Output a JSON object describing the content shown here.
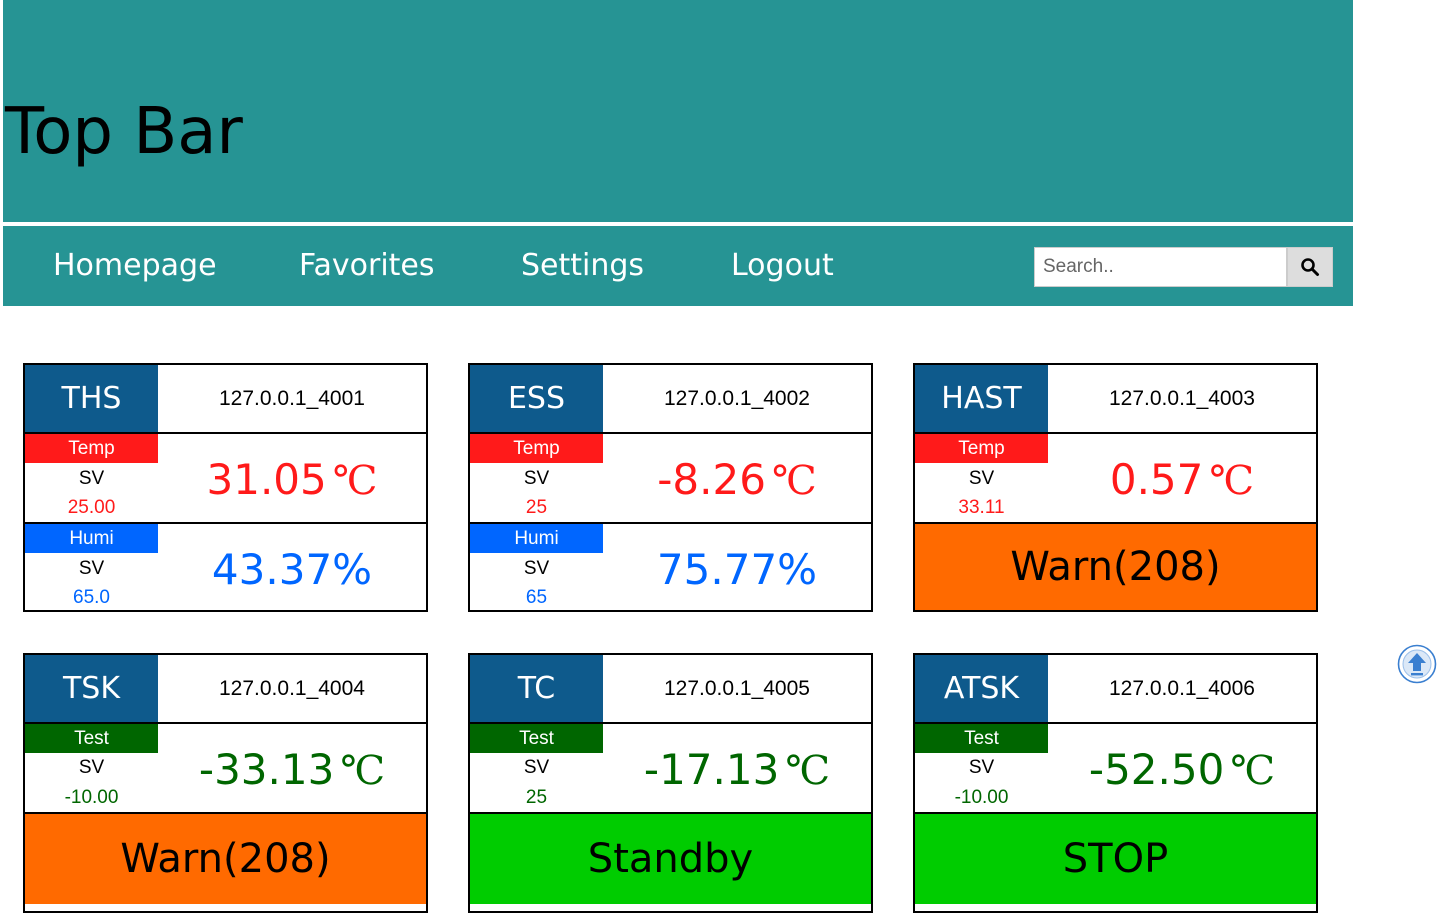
{
  "topbar": {
    "title": "Top Bar"
  },
  "nav": {
    "items": [
      "Homepage",
      "Favorites",
      "Settings",
      "Logout"
    ],
    "search_placeholder": "Search.."
  },
  "colors": {
    "teal": "#269494",
    "header_blue": "#0e5a8c",
    "temp_red": "#ff1a1a",
    "humi_blue": "#0066ff",
    "test_green": "#006600",
    "warn_orange": "#ff6a00",
    "ok_green": "#00cc00"
  },
  "icons": {
    "search": "search-icon",
    "scroll_top": "arrow-up-circle-icon"
  },
  "cards": [
    {
      "type": "THS",
      "id": "127.0.0.1_4001",
      "primary": {
        "badge": "Temp",
        "sv_label": "SV",
        "sv": "25.00",
        "value": "31.05",
        "unit": "℃"
      },
      "secondary": {
        "badge": "Humi",
        "sv_label": "SV",
        "sv": "65.0",
        "value": "43.37%"
      }
    },
    {
      "type": "ESS",
      "id": "127.0.0.1_4002",
      "primary": {
        "badge": "Temp",
        "sv_label": "SV",
        "sv": "25",
        "value": "-8.26",
        "unit": "℃"
      },
      "secondary": {
        "badge": "Humi",
        "sv_label": "SV",
        "sv": "65",
        "value": "75.77%"
      }
    },
    {
      "type": "HAST",
      "id": "127.0.0.1_4003",
      "primary": {
        "badge": "Temp",
        "sv_label": "SV",
        "sv": "33.11",
        "value": "0.57",
        "unit": "℃"
      },
      "status": "Warn(208)"
    },
    {
      "type": "TSK",
      "id": "127.0.0.1_4004",
      "primary": {
        "badge": "Test",
        "sv_label": "SV",
        "sv": "-10.00",
        "value": "-33.13",
        "unit": "℃"
      },
      "status": "Warn(208)"
    },
    {
      "type": "TC",
      "id": "127.0.0.1_4005",
      "primary": {
        "badge": "Test",
        "sv_label": "SV",
        "sv": "25",
        "value": "-17.13",
        "unit": "℃"
      },
      "status": "Standby"
    },
    {
      "type": "ATSK",
      "id": "127.0.0.1_4006",
      "primary": {
        "badge": "Test",
        "sv_label": "SV",
        "sv": "-10.00",
        "value": "-52.50",
        "unit": "℃"
      },
      "status": "STOP"
    }
  ]
}
